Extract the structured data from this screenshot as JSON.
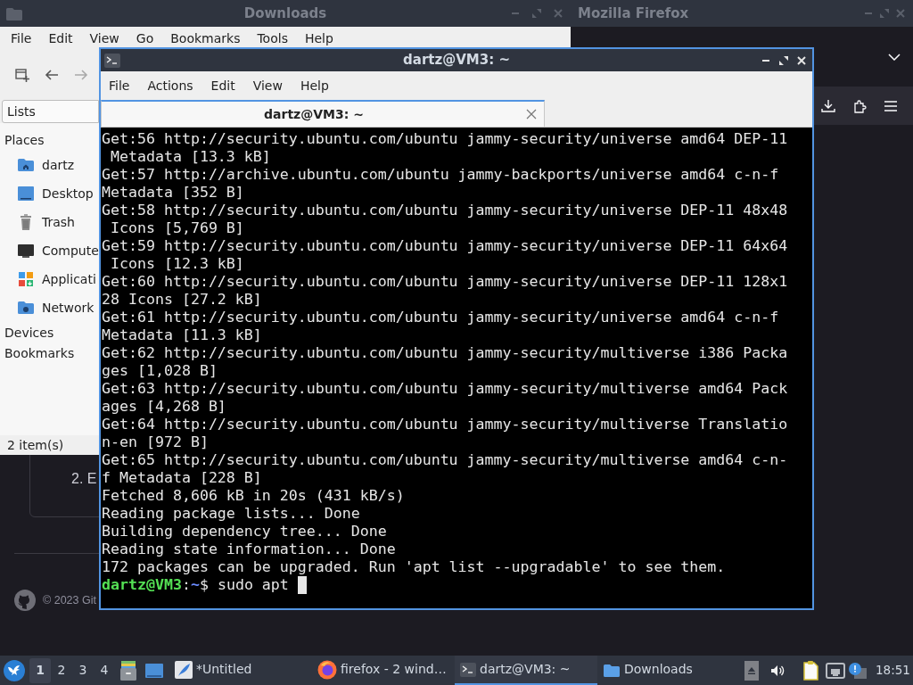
{
  "firefox": {
    "title": "Mozilla Firefox",
    "page": {
      "list_item": "2. E",
      "footer": "© 2023 Git"
    }
  },
  "file_manager": {
    "title": "Downloads",
    "menu": [
      "File",
      "Edit",
      "View",
      "Go",
      "Bookmarks",
      "Tools",
      "Help"
    ],
    "side_pane": {
      "view": "Lists",
      "sections": [
        {
          "label": "Places",
          "items": [
            {
              "label": "dartz",
              "kind": "home"
            },
            {
              "label": "Desktop",
              "kind": "desktop"
            },
            {
              "label": "Trash",
              "kind": "trash"
            },
            {
              "label": "Compute",
              "kind": "computer"
            },
            {
              "label": "Applicati",
              "kind": "applications"
            },
            {
              "label": "Network",
              "kind": "network"
            }
          ]
        },
        {
          "label": "Devices"
        },
        {
          "label": "Bookmarks"
        }
      ]
    },
    "status": "2 item(s)"
  },
  "terminal": {
    "title": "dartz@VM3: ~",
    "menu": [
      "File",
      "Actions",
      "Edit",
      "View",
      "Help"
    ],
    "tabs": [
      {
        "label": "dartz@VM3: ~",
        "selected": true
      }
    ],
    "lines": [
      "Get:56 http://security.ubuntu.com/ubuntu jammy-security/universe amd64 DEP-11",
      " Metadata [13.3 kB]",
      "Get:57 http://archive.ubuntu.com/ubuntu jammy-backports/universe amd64 c-n-f",
      "Metadata [352 B]",
      "Get:58 http://security.ubuntu.com/ubuntu jammy-security/universe DEP-11 48x48",
      " Icons [5,769 B]",
      "Get:59 http://security.ubuntu.com/ubuntu jammy-security/universe DEP-11 64x64",
      " Icons [12.3 kB]",
      "Get:60 http://security.ubuntu.com/ubuntu jammy-security/universe DEP-11 128x1",
      "28 Icons [27.2 kB]",
      "Get:61 http://security.ubuntu.com/ubuntu jammy-security/universe amd64 c-n-f",
      "Metadata [11.3 kB]",
      "Get:62 http://security.ubuntu.com/ubuntu jammy-security/multiverse i386 Packa",
      "ges [1,028 B]",
      "Get:63 http://security.ubuntu.com/ubuntu jammy-security/multiverse amd64 Pack",
      "ages [4,268 B]",
      "Get:64 http://security.ubuntu.com/ubuntu jammy-security/multiverse Translatio",
      "n-en [972 B]",
      "Get:65 http://security.ubuntu.com/ubuntu jammy-security/multiverse amd64 c-n-",
      "f Metadata [228 B]",
      "Fetched 8,606 kB in 20s (431 kB/s)",
      "Reading package lists... Done",
      "Building dependency tree... Done",
      "Reading state information... Done",
      "172 packages can be upgraded. Run 'apt list --upgradable' to see them."
    ],
    "prompt": {
      "user_host": "dartz@VM3",
      "separator": ":",
      "path": "~",
      "symbol": "$",
      "command": "sudo apt"
    }
  },
  "taskbar": {
    "workspaces": [
      {
        "label": "1",
        "selected": true
      },
      {
        "label": "2",
        "selected": false
      },
      {
        "label": "3",
        "selected": false
      },
      {
        "label": "4",
        "selected": false
      }
    ],
    "tasks": [
      {
        "label": "*Untitled",
        "kind": "editor",
        "selected": false
      },
      {
        "label": "firefox - 2 wind…",
        "kind": "browser",
        "selected": false
      },
      {
        "label": "dartz@VM3: ~",
        "kind": "terminal",
        "selected": true
      },
      {
        "label": "Downloads",
        "kind": "folder",
        "selected": false
      }
    ],
    "clock": "18:51"
  }
}
